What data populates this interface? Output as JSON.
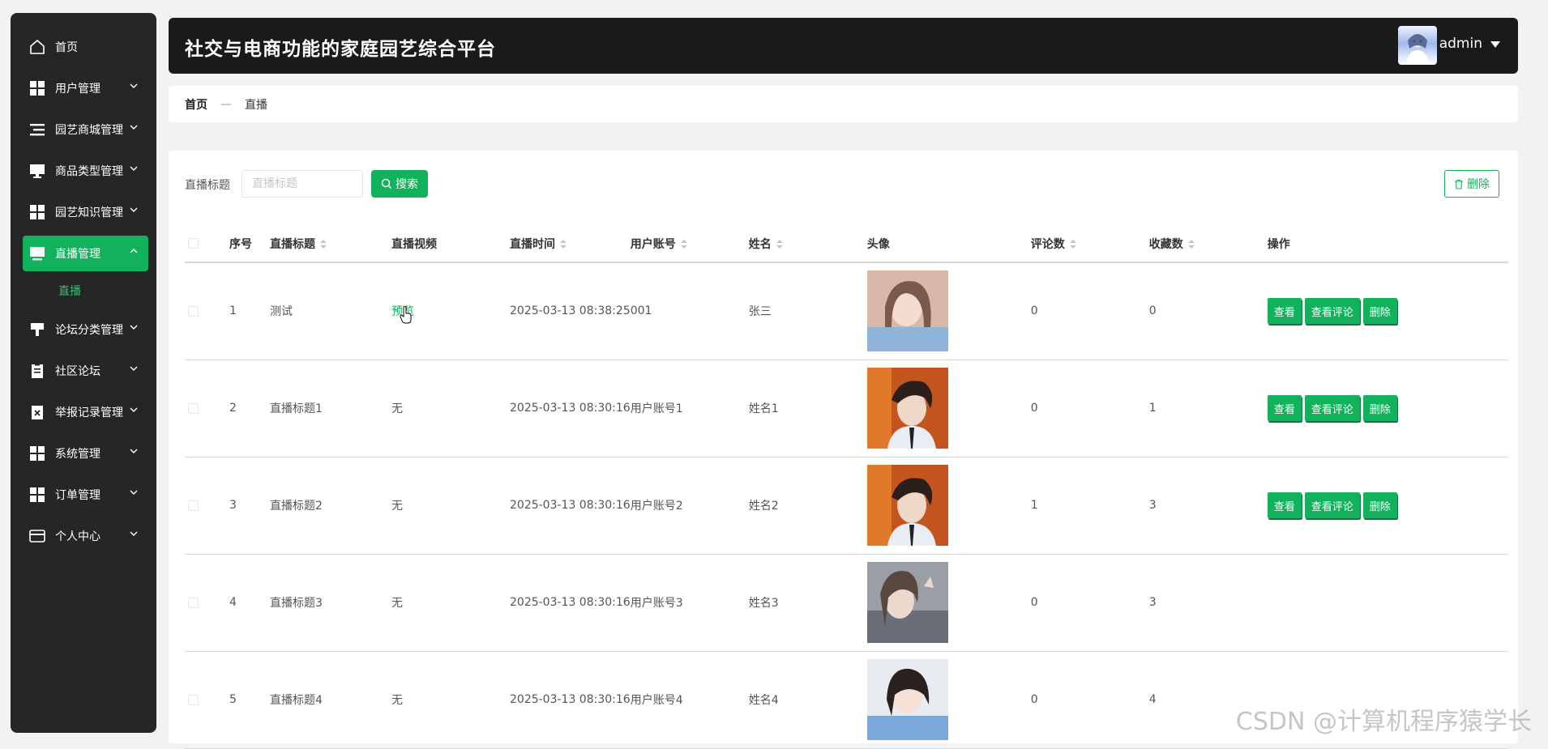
{
  "colors": {
    "accent": "#12b25d",
    "sidebar_bg": "#262626",
    "header_bg": "#1a1a1a"
  },
  "sidebar": {
    "items": [
      {
        "label": "首页",
        "icon": "home-icon"
      },
      {
        "label": "用户管理",
        "icon": "grid-icon"
      },
      {
        "label": "园艺商城管理",
        "icon": "list-icon"
      },
      {
        "label": "商品类型管理",
        "icon": "monitor-icon"
      },
      {
        "label": "园艺知识管理",
        "icon": "grid-icon"
      },
      {
        "label": "直播管理",
        "icon": "live-icon",
        "active": true
      },
      {
        "label": "论坛分类管理",
        "icon": "podium-icon"
      },
      {
        "label": "社区论坛",
        "icon": "clipboard-icon"
      },
      {
        "label": "举报记录管理",
        "icon": "report-icon"
      },
      {
        "label": "系统管理",
        "icon": "grid-icon"
      },
      {
        "label": "订单管理",
        "icon": "grid-icon"
      },
      {
        "label": "个人中心",
        "icon": "wallet-icon"
      }
    ],
    "active_sub": "直播"
  },
  "header": {
    "title": "社交与电商功能的家庭园艺综合平台",
    "user": "admin"
  },
  "breadcrumb": {
    "home": "首页",
    "sep": "—",
    "current": "直播"
  },
  "search": {
    "label": "直播标题",
    "placeholder": "直播标题",
    "button": "搜索"
  },
  "toolbar": {
    "delete": "删除"
  },
  "table": {
    "headers": {
      "index": "序号",
      "title": "直播标题",
      "video": "直播视频",
      "time": "直播时间",
      "account": "用户账号",
      "name": "姓名",
      "avatar": "头像",
      "comments": "评论数",
      "favorites": "收藏数",
      "actions": "操作"
    },
    "actions": {
      "view": "查看",
      "view_comments": "查看评论",
      "delete": "删除"
    },
    "rows": [
      {
        "index": "1",
        "title": "测试",
        "video": "预览",
        "time": "2025-03-13 08:38:25",
        "account": "001",
        "name": "张三",
        "comments": "0",
        "favorites": "0"
      },
      {
        "index": "2",
        "title": "直播标题1",
        "video": "无",
        "time": "2025-03-13 08:30:16",
        "account": "用户账号1",
        "name": "姓名1",
        "comments": "0",
        "favorites": "1"
      },
      {
        "index": "3",
        "title": "直播标题2",
        "video": "无",
        "time": "2025-03-13 08:30:16",
        "account": "用户账号2",
        "name": "姓名2",
        "comments": "1",
        "favorites": "3"
      },
      {
        "index": "4",
        "title": "直播标题3",
        "video": "无",
        "time": "2025-03-13 08:30:16",
        "account": "用户账号3",
        "name": "姓名3",
        "comments": "0",
        "favorites": "3"
      },
      {
        "index": "5",
        "title": "直播标题4",
        "video": "无",
        "time": "2025-03-13 08:30:16",
        "account": "用户账号4",
        "name": "姓名4",
        "comments": "0",
        "favorites": "4"
      }
    ]
  },
  "watermark": "CSDN @计算机程序猿学长"
}
